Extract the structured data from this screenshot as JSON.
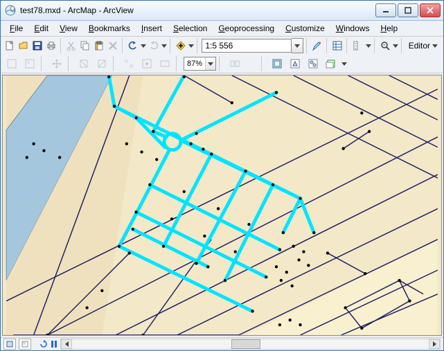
{
  "window": {
    "title": "test78.mxd - ArcMap - ArcView"
  },
  "menu": {
    "file": "File",
    "edit": "Edit",
    "view": "View",
    "bookmarks": "Bookmarks",
    "insert": "Insert",
    "selection": "Selection",
    "geoprocessing": "Geoprocessing",
    "customize": "Customize",
    "windows": "Windows",
    "help": "Help"
  },
  "toolbar": {
    "scale_value": "1:5 556",
    "zoom_value": "87%",
    "editor_label": "Editor"
  },
  "colors": {
    "highlight": "#00e5ff",
    "road": "#202060",
    "water": "#a5c7de",
    "land1": "#f3e8c8",
    "land2": "#f9f0d0",
    "land3": "#efe1bd"
  },
  "map_description": "Street network with a portion of streets highlighted (selected) in cyan, including a small roundabout. Background is a beige base map with a diagonal water feature at lower-left. Black dots mark street intersections / nodes."
}
